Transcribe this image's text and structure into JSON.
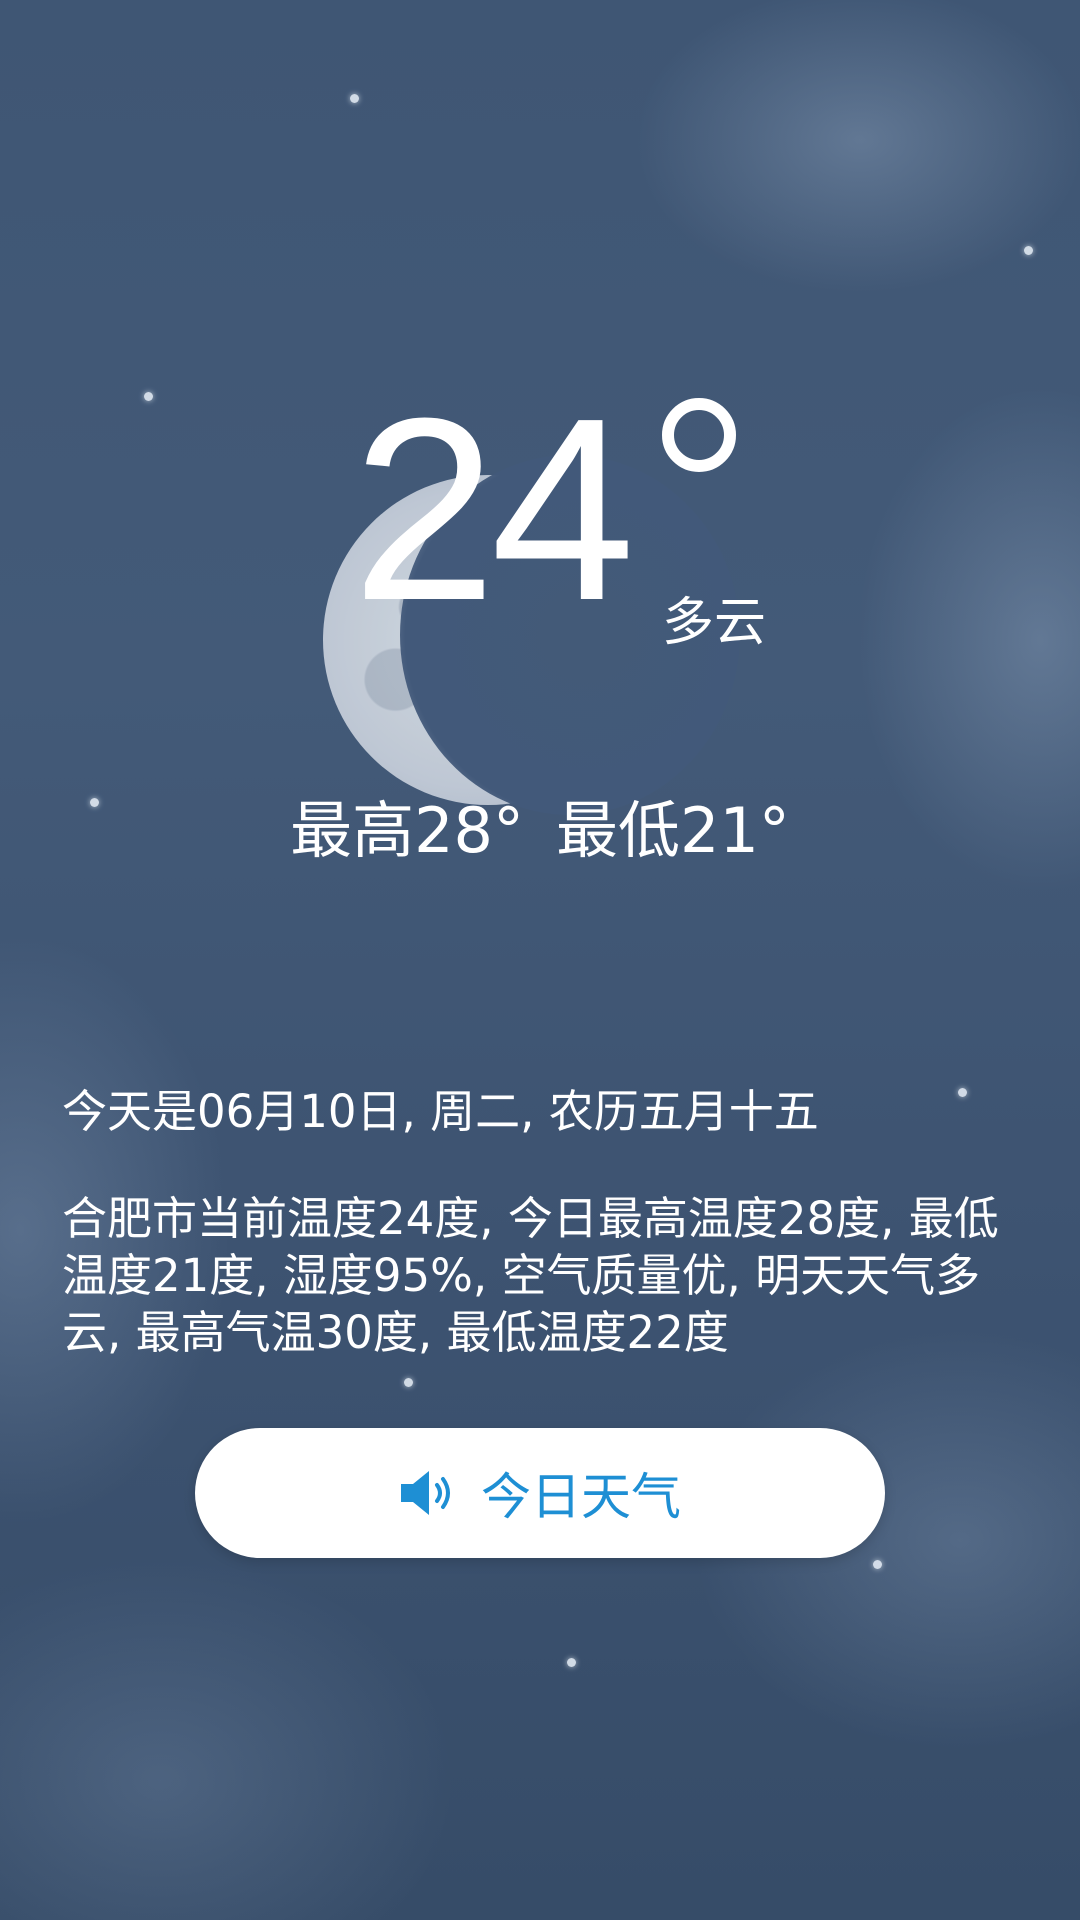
{
  "current": {
    "temperature": "24",
    "condition": "多云",
    "high": "最高28°",
    "low": "最低21°"
  },
  "date_line": "今天是06月10日, 周二, 农历五月十五",
  "report": "合肥市当前温度24度, 今日最高温度28度, 最低温度21度, 湿度95%, 空气质量优, 明天天气多云, 最高气温30度, 最低温度22度",
  "speak_button": {
    "label": "今日天气",
    "icon": "speaker-icon"
  },
  "colors": {
    "background": "#42597a",
    "text": "#ffffff",
    "button_bg": "#ffffff",
    "button_accent": "#1e8fd4"
  }
}
